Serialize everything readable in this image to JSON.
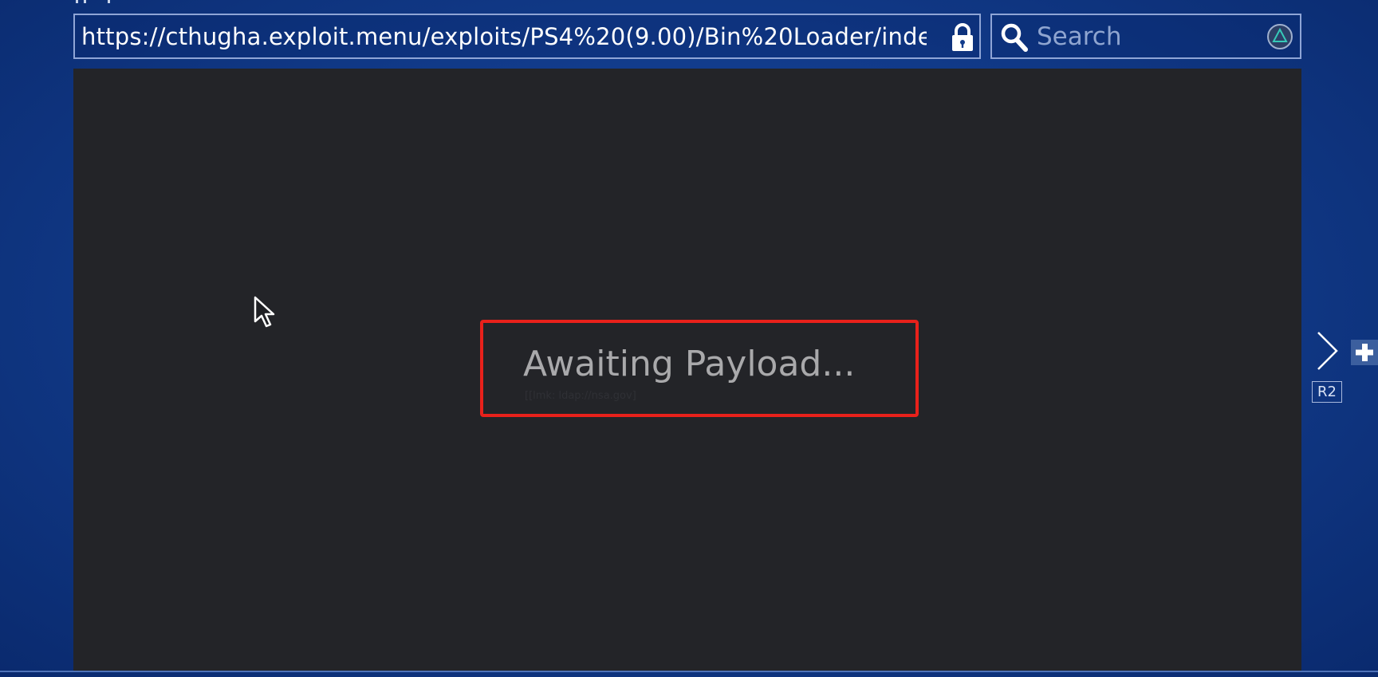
{
  "browser": {
    "url": "https://cthugha.exploit.menu/exploits/PS4%20(9.00)/Bin%20Loader/inde...",
    "search_placeholder": "Search",
    "lock_icon": "lock-icon",
    "search_icon": "search-icon",
    "triangle_button_icon": "triangle-button-icon"
  },
  "page": {
    "status_title": "Awaiting Payload...",
    "status_subtitle": "[[lmk: ldap://nsa.gov]"
  },
  "controls": {
    "r2_label": "R2",
    "next_icon": "chevron-right-icon",
    "add_icon": "plus-icon"
  },
  "colors": {
    "background_blue": "#123c8c",
    "content_bg": "#232428",
    "highlight_red": "#e8211b",
    "border_blue": "#8fa5d6"
  }
}
